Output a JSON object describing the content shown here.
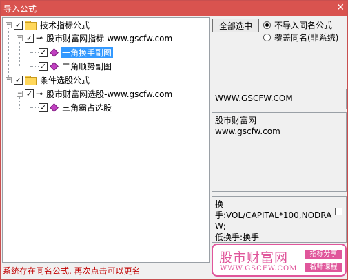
{
  "window": {
    "title": "导入公式",
    "close_glyph": "✕"
  },
  "tree": {
    "nodes": [
      {
        "label": "技术指标公式",
        "checked": true
      },
      {
        "label": "股市财富网指标-www.gscfw.com",
        "checked": true
      },
      {
        "label": "一角换手副图",
        "checked": true,
        "selected": true
      },
      {
        "label": "二角顺势副图",
        "checked": true
      },
      {
        "label": "条件选股公式",
        "checked": true
      },
      {
        "label": "股市财富网选股-www.gscfw.com",
        "checked": true
      },
      {
        "label": "三角霸占选股",
        "checked": true
      }
    ]
  },
  "controls": {
    "select_all_label": "全部选中",
    "radio_skip_label": "不导入同名公式",
    "radio_overwrite_label": "覆盖同名(非系统)"
  },
  "panels": {
    "url_text": "WWW.GSCFW.COM",
    "desc_line1": "股市财富网",
    "desc_line2": "www.gscfw.com",
    "code_line1": "换",
    "code_line2": "手:VOL/CAPITAL*100,NODRA",
    "code_line3": "W;",
    "code_line4": "低换手:换手"
  },
  "status": {
    "message": "系统存在同名公式, 再次点击可以更名"
  },
  "logo": {
    "brand": "股市财富网",
    "url": "WWW.GSCFW.COM",
    "tag1": "指标分享",
    "tag2": "名师课程",
    "color": "#e0569b"
  },
  "colors": {
    "titlebar": "#d9534f",
    "selection": "#3399ff",
    "status": "#c00000"
  }
}
